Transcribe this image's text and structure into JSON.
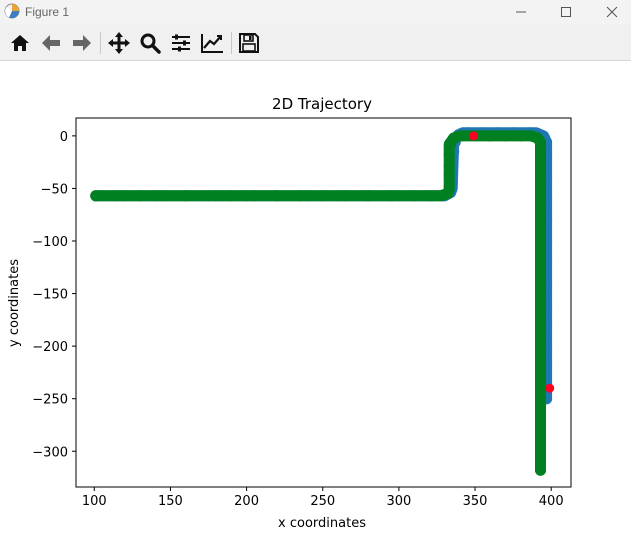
{
  "window": {
    "title": "Figure 1"
  },
  "toolbar": {
    "tools": [
      "home-icon",
      "back-arrow-icon",
      "forward-arrow-icon",
      "pan-icon",
      "zoom-icon",
      "configure-subplots-icon",
      "edit-axis-icon",
      "save-icon"
    ]
  },
  "chart_data": {
    "type": "scatter",
    "title": "2D Trajectory",
    "xlabel": "x coordinates",
    "ylabel": "y coordinates",
    "xlim": [
      88,
      413
    ],
    "ylim": [
      -334,
      17
    ],
    "xticks": [
      100,
      150,
      200,
      250,
      300,
      350,
      400
    ],
    "yticks": [
      0,
      -50,
      -100,
      -150,
      -200,
      -250,
      -300
    ],
    "grid": false,
    "colors": {
      "blue": "#1f77b4",
      "green": "#008020",
      "red": "#ff0022"
    },
    "series": [
      {
        "color": "#1f77b4",
        "path": [
          [
            101,
            -57
          ],
          [
            330,
            -57
          ],
          [
            334,
            -54
          ],
          [
            335,
            -50
          ],
          [
            336,
            -6
          ],
          [
            339,
            1
          ],
          [
            342,
            3
          ],
          [
            390,
            3
          ],
          [
            395,
            0
          ],
          [
            397,
            -6
          ],
          [
            397,
            -250
          ]
        ],
        "markers": [
          [
            101,
            -57
          ],
          [
            120,
            -57
          ],
          [
            140,
            -57
          ],
          [
            160,
            -57
          ],
          [
            180,
            -57
          ],
          [
            200,
            -57
          ],
          [
            220,
            -57
          ],
          [
            240,
            -57
          ],
          [
            260,
            -57
          ],
          [
            280,
            -57
          ],
          [
            300,
            -57
          ],
          [
            320,
            -57
          ],
          [
            330,
            -57
          ],
          [
            334,
            -53
          ],
          [
            335,
            -45
          ],
          [
            335,
            -35
          ],
          [
            335,
            -25
          ],
          [
            336,
            -15
          ],
          [
            337,
            -6
          ],
          [
            340,
            1
          ],
          [
            345,
            3
          ],
          [
            355,
            3
          ],
          [
            365,
            3
          ],
          [
            375,
            3
          ],
          [
            385,
            3
          ],
          [
            391,
            2
          ],
          [
            395,
            -1
          ],
          [
            397,
            -6
          ],
          [
            397,
            -20
          ],
          [
            397,
            -40
          ],
          [
            397,
            -60
          ],
          [
            397,
            -80
          ],
          [
            397,
            -100
          ],
          [
            397,
            -120
          ],
          [
            397,
            -140
          ],
          [
            397,
            -160
          ],
          [
            397,
            -180
          ],
          [
            397,
            -200
          ],
          [
            397,
            -220
          ],
          [
            397,
            -240
          ],
          [
            397,
            -250
          ]
        ]
      },
      {
        "color": "#008020",
        "path": [
          [
            101,
            -57
          ],
          [
            327,
            -57
          ],
          [
            332,
            -55
          ],
          [
            333,
            -51
          ],
          [
            333,
            -8
          ],
          [
            336,
            -2
          ],
          [
            340,
            0
          ],
          [
            387,
            0
          ],
          [
            391,
            -2
          ],
          [
            393,
            -6
          ],
          [
            393,
            -318
          ]
        ],
        "markers": [
          [
            101,
            -57
          ],
          [
            115,
            -57
          ],
          [
            130,
            -57
          ],
          [
            145,
            -57
          ],
          [
            160,
            -57
          ],
          [
            175,
            -57
          ],
          [
            190,
            -57
          ],
          [
            205,
            -57
          ],
          [
            220,
            -57
          ],
          [
            235,
            -57
          ],
          [
            250,
            -57
          ],
          [
            265,
            -57
          ],
          [
            280,
            -57
          ],
          [
            295,
            -57
          ],
          [
            310,
            -57
          ],
          [
            322,
            -57
          ],
          [
            328,
            -57
          ],
          [
            332,
            -54
          ],
          [
            333,
            -48
          ],
          [
            333,
            -38
          ],
          [
            333,
            -28
          ],
          [
            333,
            -18
          ],
          [
            334,
            -8
          ],
          [
            337,
            -2
          ],
          [
            341,
            0
          ],
          [
            350,
            0
          ],
          [
            360,
            0
          ],
          [
            370,
            0
          ],
          [
            380,
            0
          ],
          [
            387,
            0
          ],
          [
            391,
            -2
          ],
          [
            393,
            -7
          ],
          [
            393,
            -20
          ],
          [
            393,
            -40
          ],
          [
            393,
            -60
          ],
          [
            393,
            -80
          ],
          [
            393,
            -100
          ],
          [
            393,
            -120
          ],
          [
            393,
            -140
          ],
          [
            393,
            -160
          ],
          [
            393,
            -180
          ],
          [
            393,
            -200
          ],
          [
            393,
            -220
          ],
          [
            393,
            -240
          ],
          [
            393,
            -260
          ],
          [
            393,
            -280
          ],
          [
            393,
            -300
          ],
          [
            393,
            -318
          ]
        ]
      }
    ],
    "points": [
      {
        "x": 349,
        "y": 0,
        "color": "#ff0022"
      },
      {
        "x": 399,
        "y": -240,
        "color": "#ff0022"
      }
    ]
  }
}
